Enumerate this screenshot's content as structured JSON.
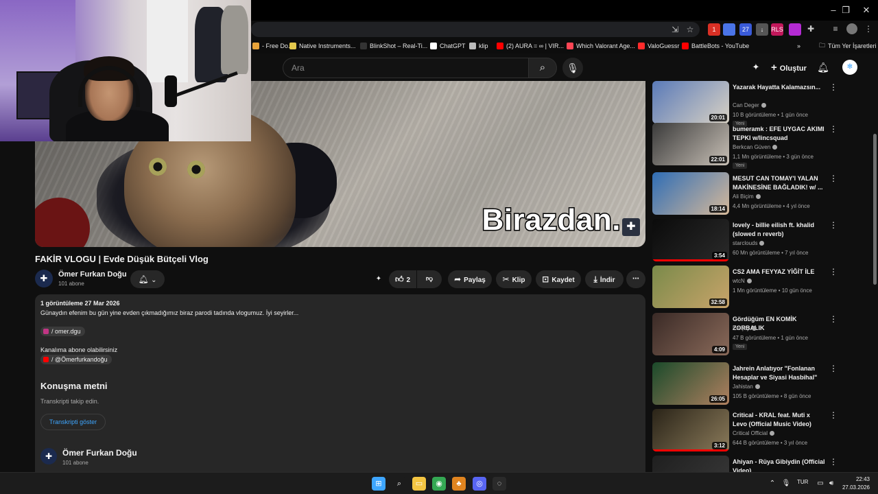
{
  "bookmarks": [
    {
      "label": "- Free Do...",
      "color": "#e8a33a"
    },
    {
      "label": "Native Instruments...",
      "color": "#e3c84d"
    },
    {
      "label": "BlinkShot – Real-Ti...",
      "color": "#333333"
    },
    {
      "label": "ChatGPT",
      "color": "#ffffff"
    },
    {
      "label": "klip",
      "color": "#bbbbbb"
    },
    {
      "label": "(2) AURA = ∞ | VIR...",
      "color": "#ff0000"
    },
    {
      "label": "Which Valorant Age...",
      "color": "#ff4655"
    },
    {
      "label": "ValoGuessr",
      "color": "#ff2b2b"
    },
    {
      "label": "BattleBots - YouTube",
      "color": "#ff0000"
    }
  ],
  "bookmarks_overflow": "»",
  "bookmarks_all": "Tüm Yer İşaretleri",
  "extensions": [
    {
      "label": "1",
      "color": "#d93025"
    },
    {
      "label": "",
      "color": "#4a74e8"
    },
    {
      "label": "27",
      "color": "#3a5bd9"
    },
    {
      "label": "↓",
      "color": "#555555"
    },
    {
      "label": "RLS",
      "color": "#c2185b"
    },
    {
      "label": "",
      "color": "#b52bd4"
    }
  ],
  "header": {
    "search_placeholder": "Ara",
    "create_label": "Oluştur"
  },
  "video": {
    "caption_text": "Birazdan.",
    "title": "FAKİR VLOGU | Evde Düşük Bütçeli Vlog",
    "channel_name": "Ömer Furkan Doğu",
    "subscribers": "101 abone",
    "likes": "2",
    "actions": {
      "share": "Paylaş",
      "clip": "Klip",
      "save": "Kaydet",
      "download": "İndir"
    }
  },
  "description": {
    "stats": "1 görüntüleme  27 Mar 2026",
    "body": "Günaydın efenim bu gün yine evden çıkmadığımız biraz parodi tadında vlogumuz. İyi seyirler...",
    "instagram_link": "/ omer.dgu",
    "subscribe_line": "Kanalıma abone olabilirsiniz",
    "youtube_link": "/ @Ömerfurkandoğu",
    "transcript_heading": "Konuşma metni",
    "transcript_sub": "Transkripti takip edin.",
    "transcript_button": "Transkripti göster",
    "channel_name": "Ömer Furkan Doğu",
    "channel_subs": "101 abone"
  },
  "recommendations": [
    {
      "title": "Yazarak Hayatta Kalamazsın...",
      "channel": "Can Deger",
      "meta": "10 B görüntüleme • 1 gün önce",
      "badge": "Yeni",
      "duration": "20:01",
      "thumb": [
        "#5a7ab8",
        "#d9d2c4"
      ],
      "progress": 0
    },
    {
      "title": "bumeramk : EFE UYGAC AKIMI TEPKI w/lincsquad",
      "channel": "Berkcan Güven",
      "meta": "1,1 Mn görüntüleme • 3 gün önce",
      "badge": "Yeni",
      "duration": "22:01",
      "thumb": [
        "#3a3a3a",
        "#c8c0b6"
      ],
      "progress": 0
    },
    {
      "title": "MESUT CAN TOMAY'I YALAN MAKİNESİNE BAĞLADIK! w/ ...",
      "channel": "Ali Biçim",
      "meta": "4,4 Mn görüntüleme • 4 yıl önce",
      "badge": "",
      "duration": "18:14",
      "thumb": [
        "#2f6db5",
        "#d6b99a"
      ],
      "progress": 0
    },
    {
      "title": "lovely - billie eilish ft. khalid (slowed n reverb)",
      "channel": "starclouds",
      "meta": "60 Mn görüntüleme • 7 yıl önce",
      "badge": "",
      "duration": "3:54",
      "thumb": [
        "#0b0b0b",
        "#2a2a2a"
      ],
      "progress": 1
    },
    {
      "title": "CS2 AMA FEYYAZ YİĞİT İLE",
      "channel": "wtcN",
      "meta": "1 Mn görüntüleme • 10 gün önce",
      "badge": "",
      "duration": "32:58",
      "thumb": [
        "#7a8a4a",
        "#c9a46a"
      ],
      "progress": 0
    },
    {
      "title": "Gördüğüm EN KOMİK ZORBALIK",
      "channel": "Porçay",
      "meta": "47 B görüntüleme • 1 gün önce",
      "badge": "Yeni",
      "duration": "4:09",
      "thumb": [
        "#3a2a26",
        "#8a6a5a"
      ],
      "progress": 0
    },
    {
      "title": "Jahrein Anlatıyor \"Fonlanan Hesaplar ve Siyasi Hasbihal\"",
      "channel": "Jahistan",
      "meta": "105 B görüntüleme • 8 gün önce",
      "badge": "",
      "duration": "26:05",
      "thumb": [
        "#1a4a2a",
        "#b08060"
      ],
      "progress": 0
    },
    {
      "title": "Critical - KRAL feat. Muti x Levo (Official Music Video)",
      "channel": "Critical Official",
      "meta": "644 B görüntüleme • 3 yıl önce",
      "badge": "",
      "duration": "3:12",
      "thumb": [
        "#2a2418",
        "#8a7a5a"
      ],
      "progress": 1
    },
    {
      "title": "Ahiyan - Rüya Gibiydin (Official Video)",
      "channel": "",
      "meta": "",
      "badge": "",
      "duration": "",
      "thumb": [
        "#1f1f1f",
        "#3a3a3a"
      ],
      "progress": 0
    }
  ],
  "taskbar": {
    "apps": [
      {
        "name": "windows-start-icon",
        "glyph": "⊞",
        "color": "#3ea6ff"
      },
      {
        "name": "search-icon",
        "glyph": "⌕",
        "color": "#1c1c1c"
      },
      {
        "name": "file-explorer-icon",
        "glyph": "▭",
        "color": "#f4c542"
      },
      {
        "name": "chrome-icon",
        "glyph": "◉",
        "color": "#34a853"
      },
      {
        "name": "fl-studio-icon",
        "glyph": "♣",
        "color": "#e0841f"
      },
      {
        "name": "discord-icon",
        "glyph": "◎",
        "color": "#5865f2"
      },
      {
        "name": "obs-icon",
        "glyph": "◌",
        "color": "#2a2a2a"
      }
    ],
    "language": "TUR",
    "time": "22:43",
    "date": "27.03.2026"
  }
}
